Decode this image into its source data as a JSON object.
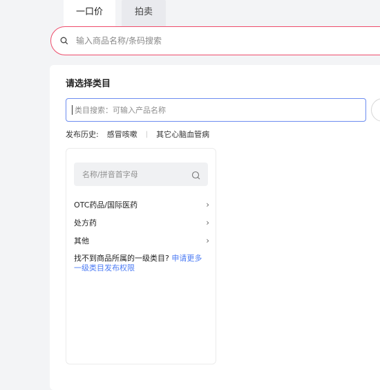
{
  "tabs": [
    {
      "label": "一口价",
      "active": true
    },
    {
      "label": "拍卖",
      "active": false
    }
  ],
  "top_search": {
    "placeholder": "输入商品名称/条码搜索",
    "icon": "search-icon"
  },
  "category_section": {
    "title": "请选择类目",
    "search_placeholder": "类目搜索：可输入产品名称",
    "history": {
      "label": "发布历史:",
      "items": [
        "感冒咳嗽",
        "其它心脑血管病"
      ]
    }
  },
  "category_panel": {
    "search_placeholder": "名称/拼音首字母",
    "items": [
      {
        "label": "OTC药品/国际医药"
      },
      {
        "label": "处方药"
      },
      {
        "label": "其他"
      }
    ],
    "notice_text": "找不到商品所属的一级类目?",
    "notice_link": "申请更多一级类目发布权限"
  },
  "colors": {
    "accent_red": "#ee4b6a",
    "focus_blue": "#6b8cf0",
    "link_blue": "#4d7cf4"
  }
}
